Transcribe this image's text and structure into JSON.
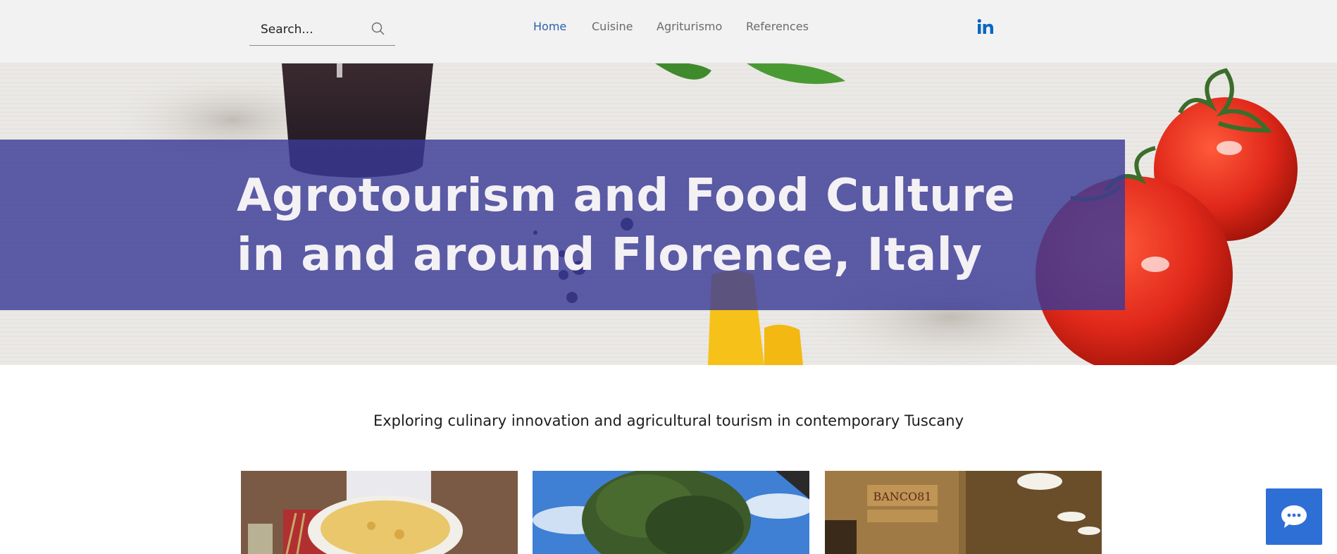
{
  "header": {
    "search_placeholder": "Search...",
    "nav": [
      {
        "label": "Home",
        "active": true
      },
      {
        "label": "Cuisine",
        "active": false
      },
      {
        "label": "Agriturismo",
        "active": false
      },
      {
        "label": "References",
        "active": false
      }
    ],
    "social_icon": "linkedin-icon"
  },
  "hero": {
    "title_line1": "Agrotourism and Food Culture",
    "title_line2": "in and around Florence, Italy"
  },
  "tagline": "Exploring culinary innovation and agricultural tourism in contemporary Tuscany",
  "gallery": [
    {
      "subject": "pizza"
    },
    {
      "subject": "tree"
    },
    {
      "subject": "shop"
    }
  ],
  "chat": {
    "icon": "chat-bubble-icon"
  },
  "colors": {
    "banner": "#3a3a96",
    "nav_active": "#2e5fa8",
    "nav_inactive": "#6b6b6b",
    "linkedin": "#0a66c2",
    "chat_button": "#2e6fd6"
  }
}
